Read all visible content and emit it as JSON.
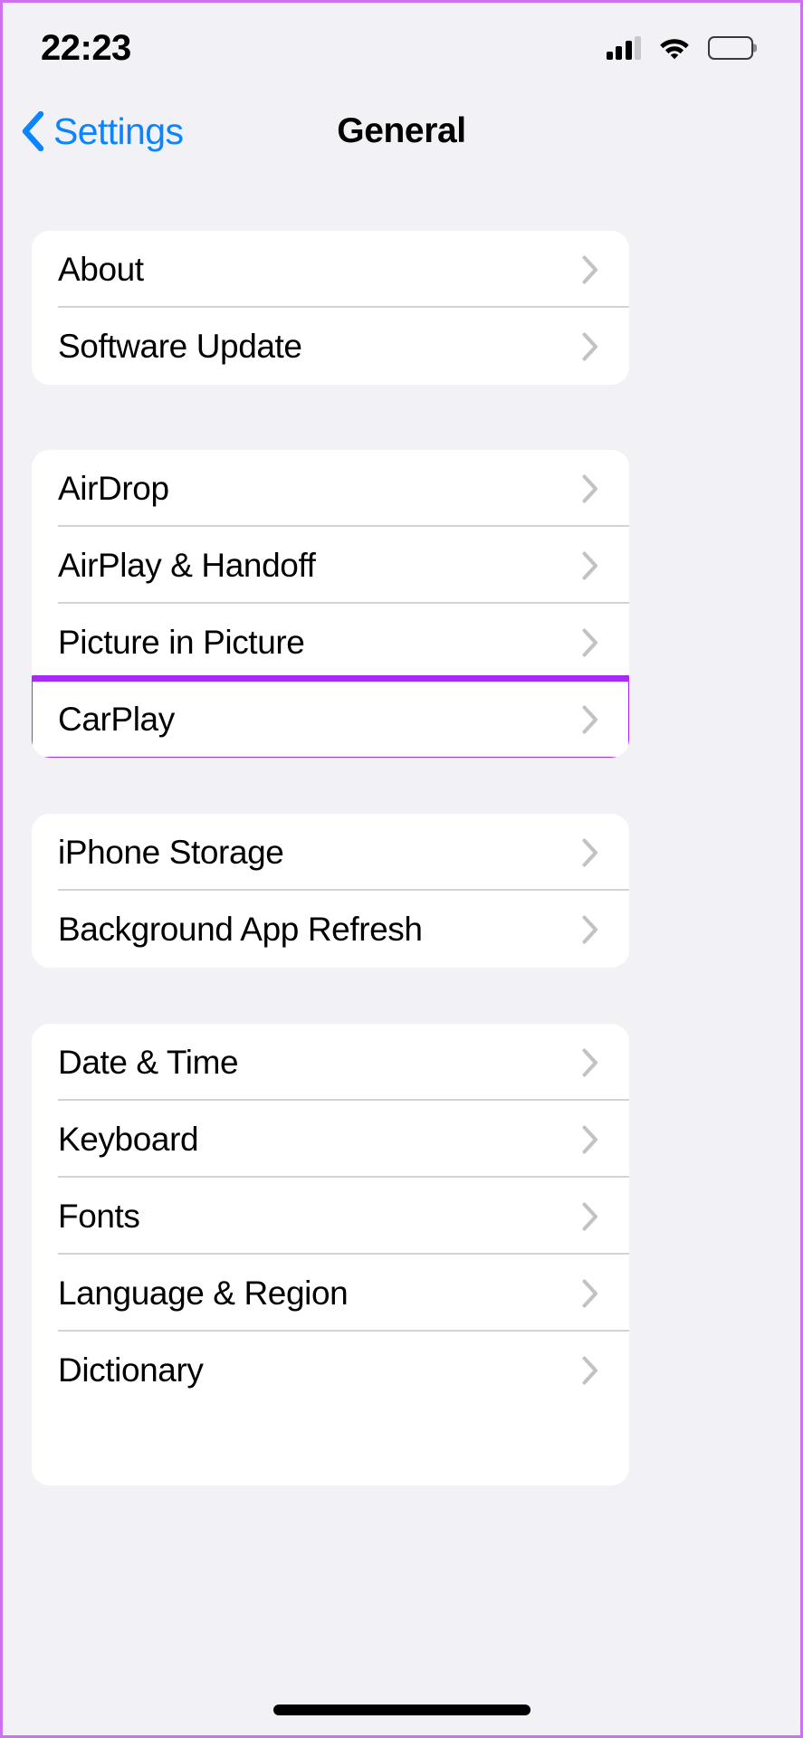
{
  "status_bar": {
    "time": "22:23",
    "signal_icon": "cellular-signal-icon",
    "signal_bars_filled": 3,
    "signal_bars_total": 4,
    "wifi_icon": "wifi-icon",
    "battery_icon": "battery-full-icon"
  },
  "nav": {
    "back_label": "Settings",
    "back_icon": "chevron-left-icon",
    "title": "General"
  },
  "colors": {
    "page_background": "#F2F1F6",
    "card_background": "#FFFFFF",
    "accent_blue": "#0A84FF",
    "highlight_purple": "#AA2AF5",
    "separator": "#D3D2D7",
    "chevron_gray": "#C2C2C6",
    "frame_border": "#CE71F0"
  },
  "groups": [
    {
      "id": "group-system",
      "rows": [
        {
          "label": "About",
          "chevron": "chevron-right-icon",
          "highlighted": false
        },
        {
          "label": "Software Update",
          "chevron": "chevron-right-icon",
          "highlighted": false
        }
      ]
    },
    {
      "id": "group-connectivity",
      "rows": [
        {
          "label": "AirDrop",
          "chevron": "chevron-right-icon",
          "highlighted": false
        },
        {
          "label": "AirPlay & Handoff",
          "chevron": "chevron-right-icon",
          "highlighted": false
        },
        {
          "label": "Picture in Picture",
          "chevron": "chevron-right-icon",
          "highlighted": false
        },
        {
          "label": "CarPlay",
          "chevron": "chevron-right-icon",
          "highlighted": true
        }
      ]
    },
    {
      "id": "group-storage",
      "rows": [
        {
          "label": "iPhone Storage",
          "chevron": "chevron-right-icon",
          "highlighted": false
        },
        {
          "label": "Background App Refresh",
          "chevron": "chevron-right-icon",
          "highlighted": false
        }
      ]
    },
    {
      "id": "group-localization",
      "rows": [
        {
          "label": "Date & Time",
          "chevron": "chevron-right-icon",
          "highlighted": false
        },
        {
          "label": "Keyboard",
          "chevron": "chevron-right-icon",
          "highlighted": false
        },
        {
          "label": "Fonts",
          "chevron": "chevron-right-icon",
          "highlighted": false
        },
        {
          "label": "Language & Region",
          "chevron": "chevron-right-icon",
          "highlighted": false
        },
        {
          "label": "Dictionary",
          "chevron": "chevron-right-icon",
          "highlighted": false
        }
      ]
    }
  ],
  "home_indicator": "home-indicator-bar"
}
